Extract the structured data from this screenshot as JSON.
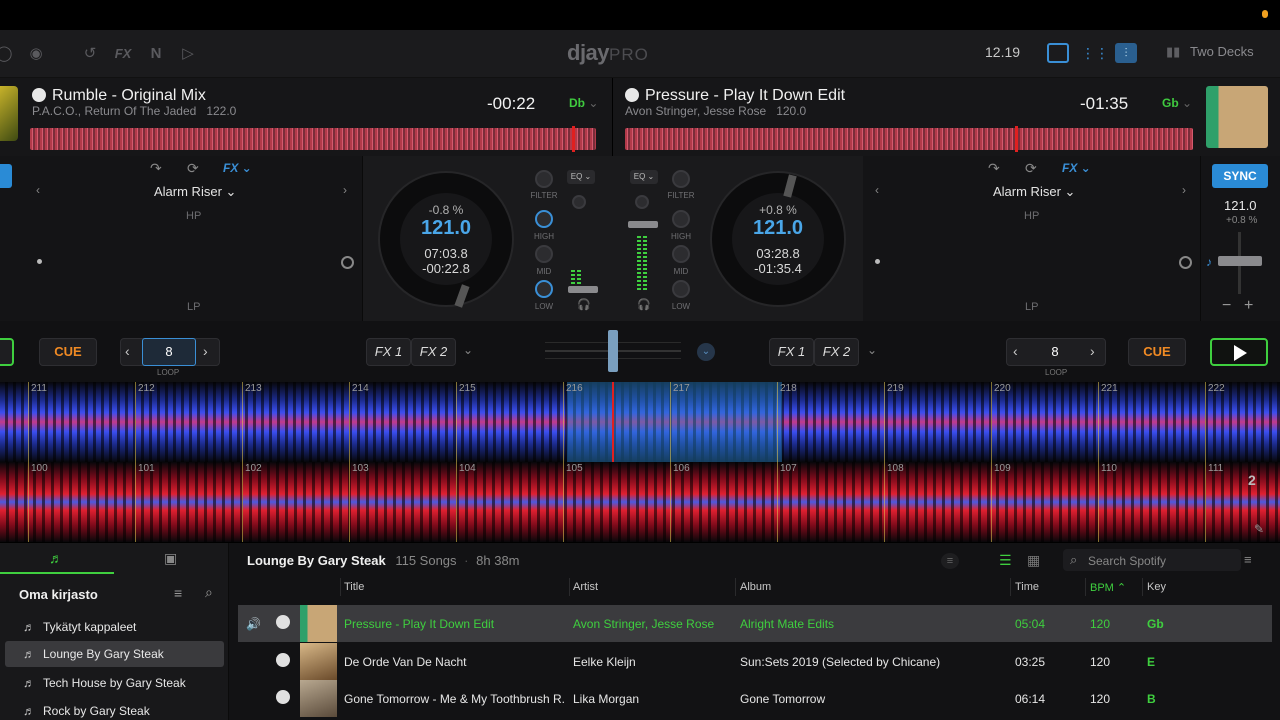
{
  "app": {
    "logo_main": "djay",
    "logo_pro": "PRO",
    "clock": "12.19",
    "layout_mode": "Two Decks"
  },
  "deck_a": {
    "title": "Rumble - Original Mix",
    "artist_album": "P.A.C.O., Return Of The Jaded",
    "bpm": "122.0",
    "remaining": "-00:22",
    "key": "Db",
    "fx_name": "Alarm Riser",
    "fx_top": "HP",
    "fx_bottom": "LP",
    "fx_label": "FX",
    "pitch_pct": "-0.8 %",
    "tempo": "121.0",
    "elapsed": "07:03.8",
    "remaining_precise": "-00:22.8",
    "cue_label": "CUE",
    "loop_value": "8",
    "loop_label": "LOOP",
    "fx1": "FX 1",
    "fx2": "FX 2",
    "beats": [
      "211",
      "212",
      "213",
      "214",
      "215",
      "216",
      "217",
      "218",
      "219",
      "220",
      "221",
      "222"
    ]
  },
  "deck_b": {
    "title": "Pressure - Play It Down Edit",
    "artist_album": "Avon Stringer, Jesse Rose",
    "bpm": "120.0",
    "remaining": "-01:35",
    "key": "Gb",
    "fx_name": "Alarm Riser",
    "fx_top": "HP",
    "fx_bottom": "LP",
    "fx_label": "FX",
    "pitch_pct": "+0.8 %",
    "tempo": "121.0",
    "elapsed": "03:28.8",
    "remaining_precise": "-01:35.4",
    "cue_label": "CUE",
    "loop_value": "8",
    "loop_label": "LOOP",
    "fx1": "FX 1",
    "fx2": "FX 2",
    "sync_label": "SYNC",
    "sync_bpm": "121.0",
    "sync_pct": "+0.8 %",
    "lane_number": "2",
    "beats": [
      "100",
      "101",
      "102",
      "103",
      "104",
      "105",
      "106",
      "107",
      "108",
      "109",
      "110",
      "111"
    ]
  },
  "mixer": {
    "filter": "FILTER",
    "high": "HIGH",
    "mid": "MID",
    "low": "LOW",
    "eq": "EQ"
  },
  "library": {
    "sidebar_title": "Oma kirjasto",
    "sidebar_items": [
      "Tykätyt kappaleet",
      "Lounge By Gary Steak",
      "Tech House by Gary Steak",
      "Rock by Gary Steak"
    ],
    "playlist_name": "Lounge By Gary Steak",
    "song_count": "115 Songs",
    "duration": "8h 38m",
    "search_placeholder": "Search Spotify",
    "columns": {
      "title": "Title",
      "artist": "Artist",
      "album": "Album",
      "time": "Time",
      "bpm": "BPM",
      "key": "Key"
    },
    "rows": [
      {
        "title": "Pressure - Play It Down Edit",
        "artist": "Avon Stringer, Jesse Rose",
        "album": "Alright Mate Edits",
        "time": "05:04",
        "bpm": "120",
        "key": "Gb"
      },
      {
        "title": "De Orde Van De Nacht",
        "artist": "Eelke Kleijn",
        "album": "Sun:Sets 2019 (Selected by Chicane)",
        "time": "03:25",
        "bpm": "120",
        "key": "E"
      },
      {
        "title": "Gone Tomorrow - Me & My Toothbrush R...",
        "artist": "Lika Morgan",
        "album": "Gone Tomorrow",
        "time": "06:14",
        "bpm": "120",
        "key": "B"
      }
    ]
  },
  "colors": {
    "accent_blue": "#3a8fd6",
    "accent_green": "#3fcf3f",
    "cue_orange": "#f08a24",
    "background": "#121214"
  }
}
